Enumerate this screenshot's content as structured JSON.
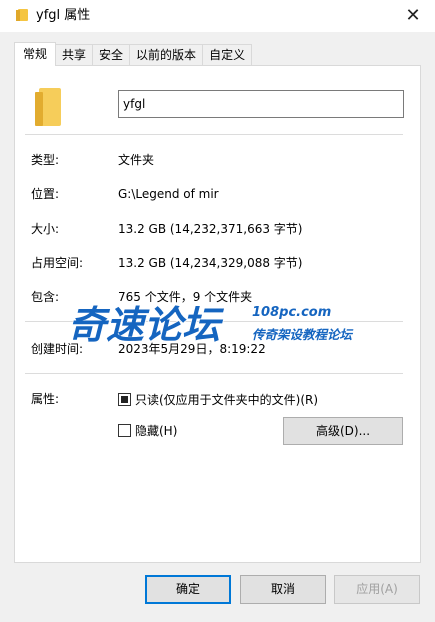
{
  "window": {
    "title": "yfgl 属性",
    "close_glyph": "✕"
  },
  "tabs": [
    {
      "label": "常规",
      "active": true
    },
    {
      "label": "共享"
    },
    {
      "label": "安全"
    },
    {
      "label": "以前的版本"
    },
    {
      "label": "自定义"
    }
  ],
  "general": {
    "folder_name": "yfgl",
    "rows": [
      {
        "label": "类型:",
        "value": "文件夹"
      },
      {
        "label": "位置:",
        "value": "G:\\Legend of mir"
      },
      {
        "label": "大小:",
        "value": "13.2 GB (14,232,371,663 字节)"
      },
      {
        "label": "占用空间:",
        "value": "13.2 GB (14,234,329,088 字节)"
      },
      {
        "label": "包含:",
        "value": "765 个文件，9 个文件夹"
      },
      {
        "label": "创建时间:",
        "value": "2023年5月29日，8:19:22"
      }
    ],
    "attributes_label": "属性:",
    "readonly_label": "只读(仅应用于文件夹中的文件)(R)",
    "hidden_label": "隐藏(H)",
    "advanced_label": "高级(D)..."
  },
  "buttons": {
    "ok": "确定",
    "cancel": "取消",
    "apply": "应用(A)"
  },
  "watermark": {
    "main": "奇速论坛",
    "url": "108pc.com",
    "sub": "传奇架设教程论坛"
  },
  "icons": {
    "folder": "folder-icon",
    "close": "close-icon"
  },
  "colors": {
    "accent": "#0078d7",
    "watermark_blue": "#1565c0",
    "folder_yellow": "#f6cd5a"
  }
}
